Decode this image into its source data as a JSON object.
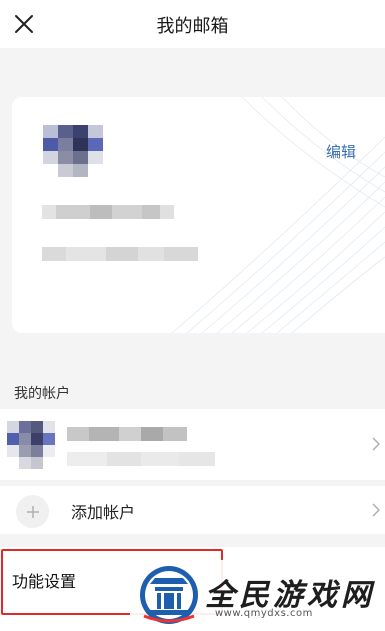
{
  "header": {
    "title": "我的邮箱",
    "close_icon": "close-icon"
  },
  "profile_card": {
    "edit_label": "编辑"
  },
  "accounts_section": {
    "label": "我的帐户"
  },
  "add_account": {
    "label": "添加帐户"
  },
  "settings": {
    "label": "功能设置"
  },
  "watermark": {
    "name": "全民游戏网",
    "url": "www.qmydxs.com"
  },
  "colors": {
    "accent": "#3a6fb5",
    "highlight": "#e02a2a",
    "background": "#f4f4f4"
  }
}
